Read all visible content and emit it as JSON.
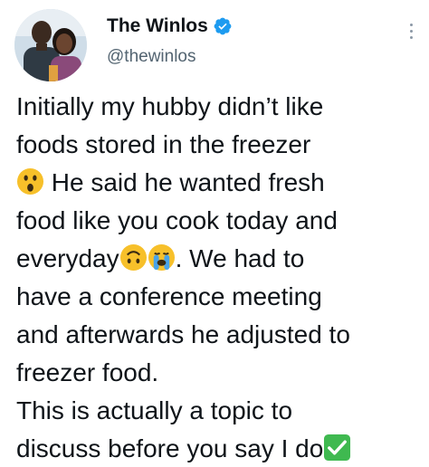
{
  "user": {
    "display_name": "The Winlos",
    "handle": "@thewinlos",
    "verified": true,
    "avatar_icon": "avatar-photo-couple"
  },
  "more_icon": "more-vertical-icon",
  "tweet": {
    "line1": "Initially my hubby didn’t like",
    "line2": "foods stored in the freezer",
    "line3_text": "He said he wanted fresh",
    "line4": "food like you cook today and",
    "line5_a": "everyday",
    "line5_b": ". We had to",
    "line6": "have a conference meeting",
    "line7": "and afterwards he adjusted to",
    "line8": "freezer food.",
    "line9": "This is actually a topic to",
    "line10": "discuss before you say I do"
  },
  "emojis": [
    "astonished-face-emoji",
    "upside-down-face-emoji",
    "loudly-crying-face-emoji",
    "check-mark-button-emoji"
  ],
  "colors": {
    "text": "#0f1419",
    "secondary": "#536471",
    "verified_blue": "#1d9bf0",
    "check_green": "#3fb950"
  }
}
